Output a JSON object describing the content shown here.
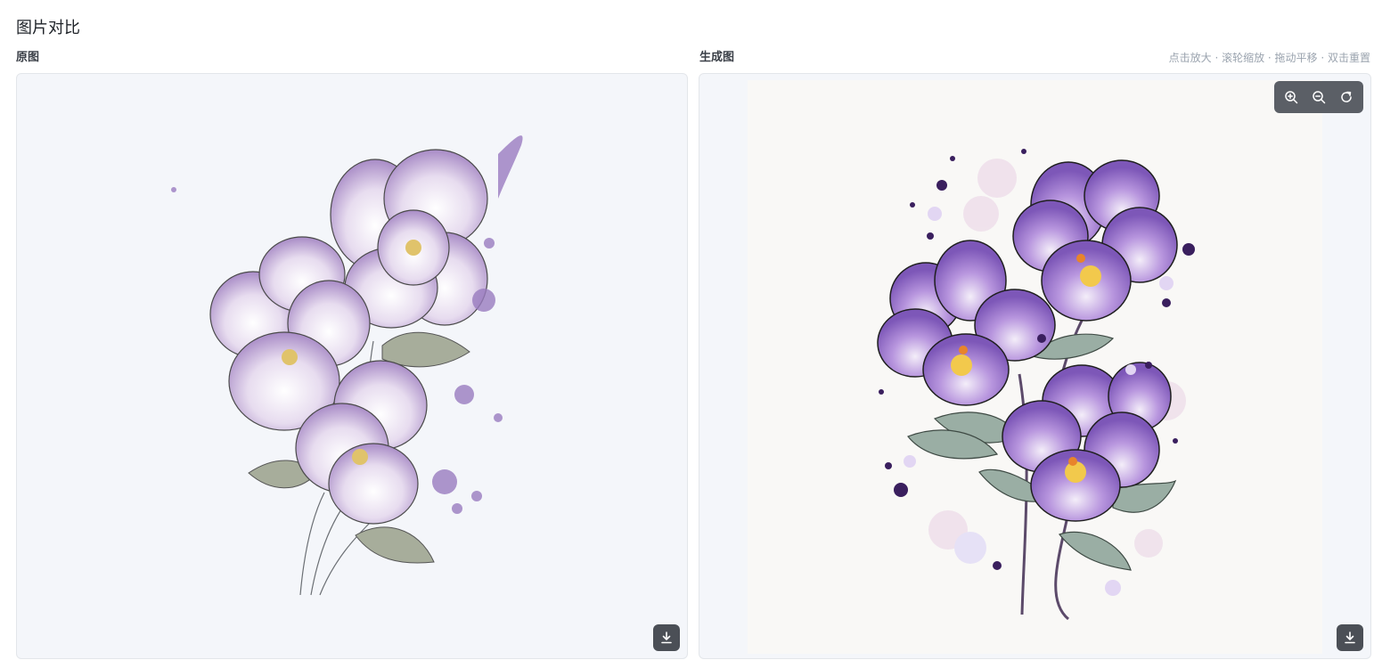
{
  "page": {
    "title": "图片对比"
  },
  "left_panel": {
    "label": "原图",
    "download_icon": "download-icon"
  },
  "right_panel": {
    "label": "生成图",
    "hint": "点击放大 · 滚轮缩放 · 拖动平移 · 双击重置",
    "toolbar": {
      "zoom_in_icon": "zoom-in-icon",
      "zoom_out_icon": "zoom-out-icon",
      "reset_icon": "reset-icon"
    },
    "download_icon": "download-icon"
  },
  "colors": {
    "panel_bg": "#f4f6fa",
    "toolbar_bg": "#5b5f66",
    "button_bg": "#4b4f56",
    "petal_light": "#c9b3e0",
    "petal_dark": "#7d5aa8",
    "leaf": "#8fa39a"
  }
}
